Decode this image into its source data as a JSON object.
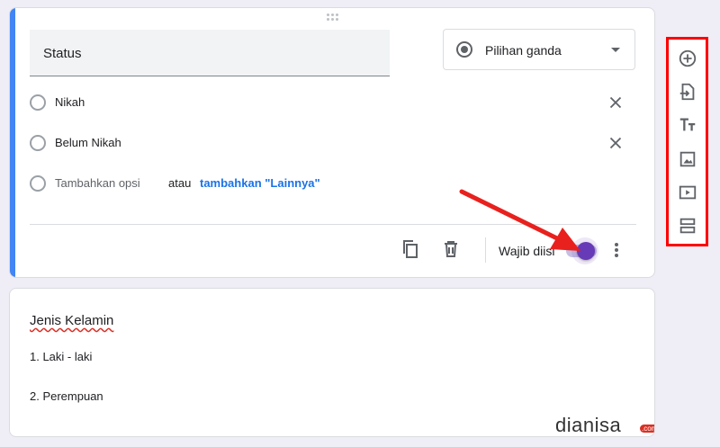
{
  "question1": {
    "title": "Status",
    "type_label": "Pilihan ganda",
    "options": [
      {
        "label": "Nikah"
      },
      {
        "label": "Belum Nikah"
      }
    ],
    "add_option": "Tambahkan opsi",
    "or_text": "atau",
    "add_other": "tambahkan \"Lainnya\"",
    "required_label": "Wajib diisi",
    "required_on": true
  },
  "question2": {
    "title": "Jenis Kelamin",
    "items": [
      "1.  Laki - laki",
      "2.  Perempuan"
    ]
  },
  "toolbar": {
    "items": [
      "add-question-icon",
      "import-questions-icon",
      "add-title-icon",
      "add-image-icon",
      "add-video-icon",
      "add-section-icon"
    ]
  },
  "watermark": {
    "brand": "dianisa",
    "suffix": ".com"
  },
  "colors": {
    "accent_blue": "#4285f4",
    "toggle_purple": "#673ab7",
    "highlight_red": "#ff0000",
    "link_blue": "#1a73e8"
  }
}
